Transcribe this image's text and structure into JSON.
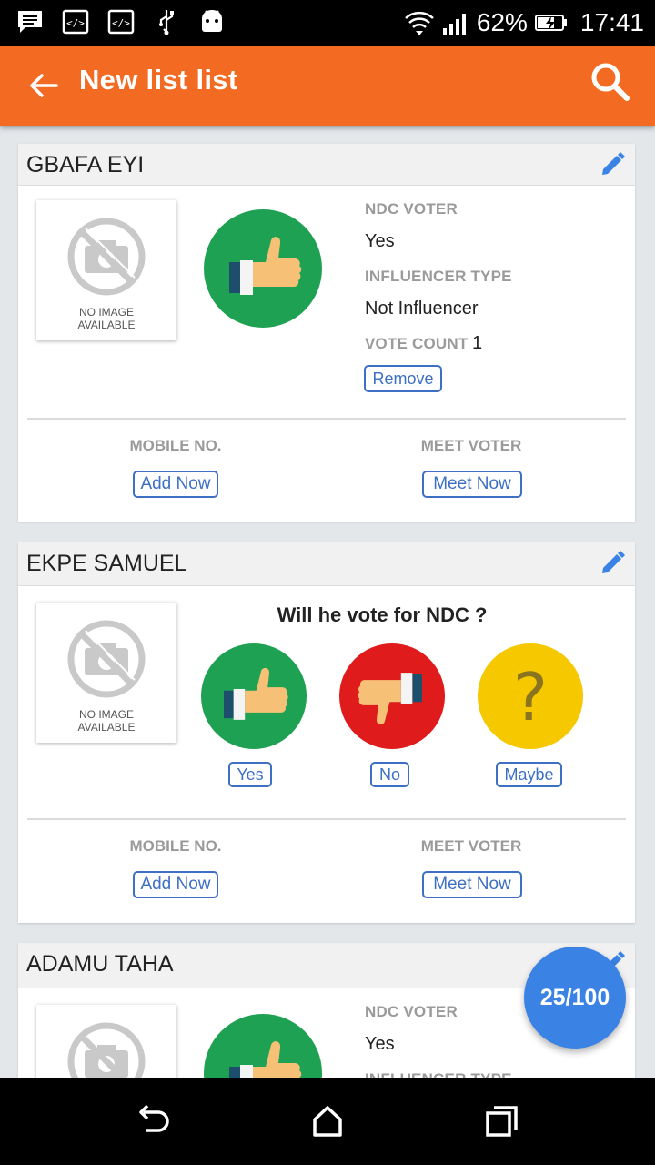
{
  "status_bar": {
    "icons": [
      "message-icon",
      "code-icon",
      "code-icon",
      "usb-icon",
      "android-icon"
    ],
    "battery_percent": "62%",
    "time": "17:41"
  },
  "app_bar": {
    "title": "New list list",
    "back_icon": "arrow-left-icon",
    "search_icon": "search-icon",
    "background": "#f36a22"
  },
  "photo_placeholder": {
    "line1": "NO IMAGE",
    "line2": "AVAILABLE"
  },
  "cards": [
    {
      "name": "GBAFA EYI",
      "ndc_voter_label": "NDC VOTER",
      "ndc_voter_value": "Yes",
      "influencer_label": "INFLUENCER TYPE",
      "influencer_value": "Not Influencer",
      "vote_count_label": "VOTE COUNT",
      "vote_count_value": "1",
      "remove_label": "Remove",
      "mobile_label": "MOBILE NO.",
      "add_now_label": "Add Now",
      "meet_label": "MEET VOTER",
      "meet_now_label": "Meet Now"
    },
    {
      "name": "EKPE SAMUEL",
      "question": "Will he vote for NDC ?",
      "options": [
        {
          "label": "Yes",
          "icon": "thumbs-up-icon",
          "color": "#1ea153"
        },
        {
          "label": "No",
          "icon": "thumbs-down-icon",
          "color": "#e01b1b"
        },
        {
          "label": "Maybe",
          "icon": "question-icon",
          "color": "#f5c800"
        }
      ],
      "mobile_label": "MOBILE NO.",
      "add_now_label": "Add Now",
      "meet_label": "MEET VOTER",
      "meet_now_label": "Meet Now"
    },
    {
      "name": "ADAMU TAHA",
      "ndc_voter_label": "NDC VOTER",
      "ndc_voter_value": "Yes",
      "influencer_label": "INFLUENCER TYPE"
    }
  ],
  "fab": {
    "label": "25/100",
    "color": "#3a82e4"
  },
  "nav_bar": {
    "icons": [
      "back-nav-icon",
      "home-nav-icon",
      "recents-nav-icon"
    ]
  },
  "colors": {
    "accent": "#3d6fc4",
    "brand": "#f36a22"
  }
}
